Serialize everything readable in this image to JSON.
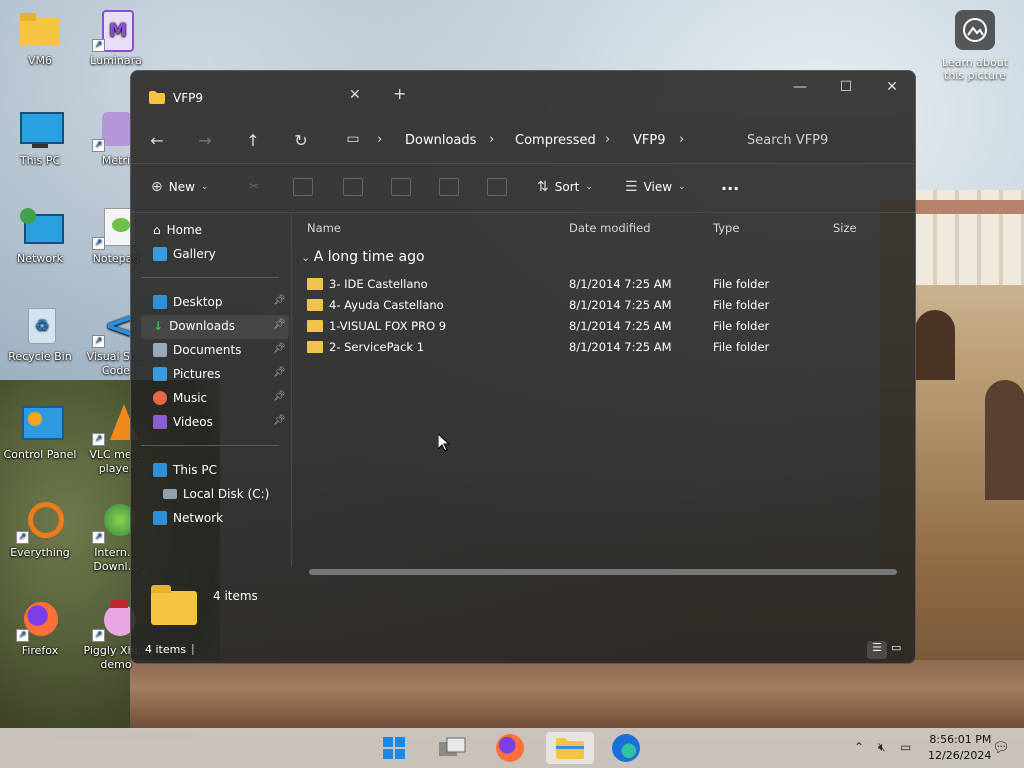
{
  "desktop": {
    "icons": [
      {
        "label": "VM6",
        "icon": "folder-icon"
      },
      {
        "label": "Luminara",
        "icon": "app-icon"
      },
      {
        "label": "This PC",
        "icon": "monitor-icon"
      },
      {
        "label": "Metri",
        "icon": "app-icon"
      },
      {
        "label": "Network",
        "icon": "network-icon"
      },
      {
        "label": "Notepad",
        "icon": "notepad-icon"
      },
      {
        "label": "Recycle Bin",
        "icon": "recycle-bin-icon"
      },
      {
        "label": "Visual St… Code",
        "icon": "vscode-icon"
      },
      {
        "label": "Control Panel",
        "icon": "control-panel-icon"
      },
      {
        "label": "VLC me… player",
        "icon": "vlc-icon"
      },
      {
        "label": "Everything",
        "icon": "search-app-icon"
      },
      {
        "label": "Intern… Downl…",
        "icon": "download-manager-icon"
      },
      {
        "label": "Firefox",
        "icon": "firefox-icon"
      },
      {
        "label": "Piggly Xhi… demo",
        "icon": "game-icon"
      }
    ],
    "learn": "Learn about this picture"
  },
  "explorer": {
    "tab_title": "VFP9",
    "breadcrumb": [
      "Downloads",
      "Compressed",
      "VFP9"
    ],
    "search_placeholder": "Search VFP9",
    "toolbar": {
      "new_label": "New",
      "sort_label": "Sort",
      "view_label": "View",
      "more_label": "···"
    },
    "sidebar": {
      "items": [
        {
          "label": "Home",
          "icon": "home-icon"
        },
        {
          "label": "Gallery",
          "icon": "gallery-icon"
        },
        {
          "label": "Desktop",
          "icon": "desktop-icon",
          "pinned": true
        },
        {
          "label": "Downloads",
          "icon": "download-icon",
          "pinned": true,
          "selected": true
        },
        {
          "label": "Documents",
          "icon": "documents-icon",
          "pinned": true
        },
        {
          "label": "Pictures",
          "icon": "pictures-icon",
          "pinned": true
        },
        {
          "label": "Music",
          "icon": "music-icon",
          "pinned": true
        },
        {
          "label": "Videos",
          "icon": "videos-icon",
          "pinned": true
        },
        {
          "label": "This PC",
          "icon": "pc-icon"
        },
        {
          "label": "Local Disk (C:)",
          "icon": "disk-icon"
        },
        {
          "label": "Network",
          "icon": "network-icon"
        }
      ]
    },
    "columns": [
      "Name",
      "Date modified",
      "Type",
      "Size"
    ],
    "group": "A long time ago",
    "rows": [
      {
        "name": "3- IDE Castellano",
        "date": "8/1/2014 7:25 AM",
        "type": "File folder"
      },
      {
        "name": "4- Ayuda Castellano",
        "date": "8/1/2014 7:25 AM",
        "type": "File folder"
      },
      {
        "name": "1-VISUAL FOX PRO 9",
        "date": "8/1/2014 7:25 AM",
        "type": "File folder"
      },
      {
        "name": "2- ServicePack 1",
        "date": "8/1/2014 7:25 AM",
        "type": "File folder"
      }
    ],
    "details_count": "4 items",
    "status_count": "4 items"
  },
  "taskbar": {
    "apps": [
      "start-icon",
      "task-view-icon",
      "firefox-icon",
      "file-explorer-icon",
      "edge-icon"
    ],
    "time": "8:56:01 PM",
    "date": "12/26/2024"
  },
  "colors": {
    "folder": "#f2c34a",
    "accent": "#4cc2ff"
  }
}
